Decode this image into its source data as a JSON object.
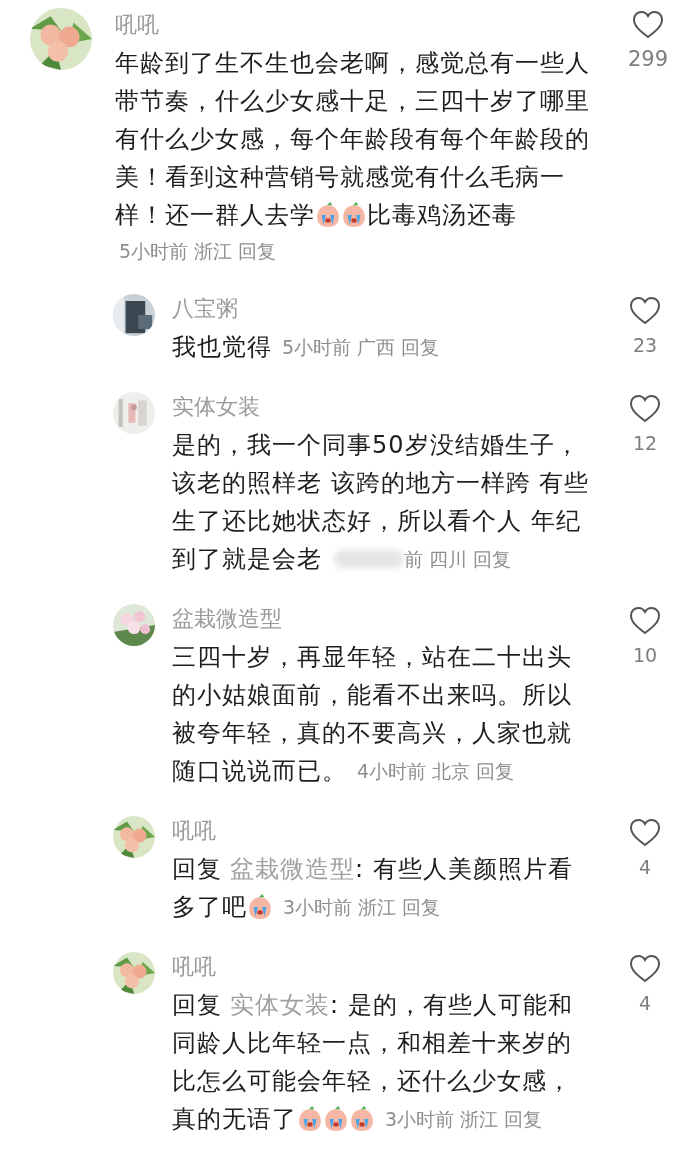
{
  "comments": [
    {
      "kind": "main",
      "name": "吼吼",
      "lines": [
        [
          {
            "kind": "text",
            "text": "年龄到了生不生也会老啊，感觉总有一些人"
          }
        ],
        [
          {
            "kind": "text",
            "text": "带节奏，什么少女感十足，三四十岁了哪里"
          }
        ],
        [
          {
            "kind": "text",
            "text": "有什么少女感，每个年龄段有每个年龄段的"
          }
        ],
        [
          {
            "kind": "text",
            "text": "美！看到这种营销号就感觉有什么毛病一"
          }
        ],
        [
          {
            "kind": "text",
            "text": "样！还一群人去学"
          },
          {
            "kind": "emoji"
          },
          {
            "kind": "emoji"
          },
          {
            "kind": "text",
            "text": "比毒鸡汤还毒"
          }
        ]
      ],
      "time": "5小时前",
      "location": "浙江",
      "reply": "回复",
      "likes": "299"
    },
    {
      "kind": "reply",
      "name": "八宝粥",
      "lines": [
        [
          {
            "kind": "text",
            "text": "我也觉得"
          }
        ]
      ],
      "time": "5小时前",
      "location": "广西",
      "reply": "回复",
      "likes": "23"
    },
    {
      "kind": "reply",
      "name": "实体女装",
      "lines": [
        [
          {
            "kind": "text",
            "text": "是的，我一个同事50岁没结婚生子，"
          }
        ],
        [
          {
            "kind": "text",
            "text": "该老的照样老 该跨的地方一样跨 有些"
          }
        ],
        [
          {
            "kind": "text",
            "text": "生了还比她状态好，所以看个人 年纪"
          }
        ],
        [
          {
            "kind": "text",
            "text": "到了就是会老"
          }
        ]
      ],
      "time_blurred": true,
      "time": "前",
      "location": "四川",
      "reply": "回复",
      "likes": "12"
    },
    {
      "kind": "reply",
      "name": "盆栽微造型",
      "lines": [
        [
          {
            "kind": "text",
            "text": "三四十岁，再显年轻，站在二十出头"
          }
        ],
        [
          {
            "kind": "text",
            "text": "的小姑娘面前，能看不出来吗。所以"
          }
        ],
        [
          {
            "kind": "text",
            "text": "被夸年轻，真的不要高兴，人家也就"
          }
        ],
        [
          {
            "kind": "text",
            "text": "随口说说而已。"
          }
        ]
      ],
      "time": "4小时前",
      "location": "北京",
      "reply": "回复",
      "likes": "10"
    },
    {
      "kind": "reply",
      "name": "吼吼",
      "lines": [
        [
          {
            "kind": "text",
            "text": "回复"
          },
          {
            "kind": "mention",
            "text": "盆栽微造型"
          },
          {
            "kind": "text",
            "text": ": 有些人美颜照片看"
          }
        ],
        [
          {
            "kind": "text",
            "text": "多了吧"
          },
          {
            "kind": "emoji"
          }
        ]
      ],
      "time": "3小时前",
      "location": "浙江",
      "reply": "回复",
      "likes": "4"
    },
    {
      "kind": "reply",
      "name": "吼吼",
      "lines": [
        [
          {
            "kind": "text",
            "text": "回复"
          },
          {
            "kind": "mention",
            "text": "实体女装"
          },
          {
            "kind": "text",
            "text": ": 是的，有些人可能和"
          }
        ],
        [
          {
            "kind": "text",
            "text": "同龄人比年轻一点，和相差十来岁的"
          }
        ],
        [
          {
            "kind": "text",
            "text": "比怎么可能会年轻，还什么少女感，"
          }
        ],
        [
          {
            "kind": "text",
            "text": "真的无语了"
          },
          {
            "kind": "emoji"
          },
          {
            "kind": "emoji"
          },
          {
            "kind": "emoji"
          }
        ]
      ],
      "time": "3小时前",
      "location": "浙江",
      "reply": "回复",
      "likes": "4"
    }
  ]
}
